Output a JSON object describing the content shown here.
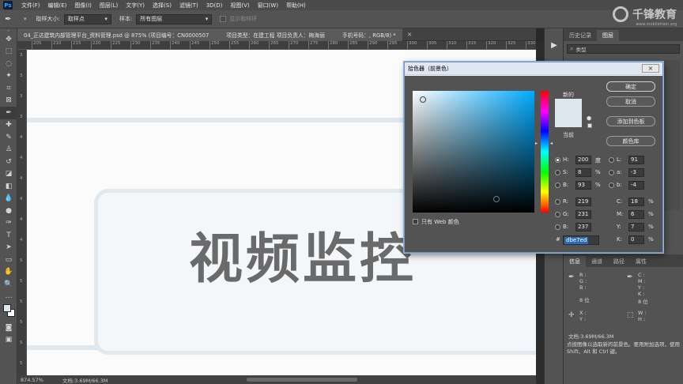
{
  "menubar": {
    "logo": "Ps",
    "items": [
      "文件(F)",
      "编辑(E)",
      "图像(I)",
      "图层(L)",
      "文字(Y)",
      "选择(S)",
      "滤镜(T)",
      "3D(D)",
      "视图(V)",
      "窗口(W)",
      "帮助(H)"
    ]
  },
  "options": {
    "sample_size_label": "取样大小:",
    "sample_size_value": "取样点",
    "sample_label": "样本:",
    "sample_value": "所有图层",
    "show_ring_label": "显示取样环"
  },
  "watermark": {
    "text": "千锋教育",
    "sub": "www.mobiletrain.org"
  },
  "doc_tab": {
    "file": "04_正达建筑内部管理平台_资料管理.psd @ 875% (项目编号：CN0000507",
    "type": "项目类型：在建工程  项目负责人：梅海丽",
    "phone": "手机号码：, RGB/8) *",
    "close": "×"
  },
  "ruler_ticks": [
    "205",
    "210",
    "215",
    "220",
    "225",
    "230",
    "235",
    "240",
    "245",
    "250",
    "255",
    "260",
    "265",
    "270",
    "275",
    "280",
    "285",
    "290",
    "295",
    "300",
    "305",
    "310",
    "315",
    "320",
    "325",
    "330"
  ],
  "ruler_ticks_left": [
    "3",
    "3",
    "3",
    "3",
    "4",
    "4",
    "4",
    "4",
    "4",
    "4",
    "5",
    "5",
    "5",
    "5",
    "5",
    "5"
  ],
  "canvas": {
    "title_text": "视频监控"
  },
  "status": {
    "zoom": "874.57%",
    "doc": "文档:3.69M/66.3M"
  },
  "panels": {
    "top_tabs": [
      "历史记录",
      "图层"
    ],
    "search_kind": "类型",
    "bottom_tabs": [
      "信息",
      "通道",
      "路径",
      "属性"
    ],
    "info": {
      "r": "R :",
      "g": "G :",
      "b": "B :",
      "c": "C :",
      "m": "M :",
      "y": "Y :",
      "k": "K :",
      "bit1": "8 位",
      "bit2": "8 位",
      "x": "X :",
      "yy": "Y :",
      "w": "W :",
      "h": "H :",
      "doc": "文档:3.69M/66.3M",
      "hint": "点按图像以选取新的前景色。要用附加选项，使用 Shift、Alt 和 Ctrl 键。"
    }
  },
  "picker": {
    "title": "拾色器（前景色）",
    "close": "×",
    "new_label": "新的",
    "current_label": "当前",
    "new_color": "#dbe7ed",
    "current_color": "#dbe7ed",
    "ok": "确定",
    "cancel": "取消",
    "add_swatch": "添加到色板",
    "libraries": "颜色库",
    "web_only": "只有 Web 颜色",
    "h_label": "H:",
    "h_value": "200",
    "h_unit": "度",
    "s_label": "S:",
    "s_value": "8",
    "s_unit": "%",
    "bv_label": "B:",
    "bv_value": "93",
    "bv_unit": "%",
    "r_label": "R:",
    "r_value": "219",
    "g_label": "G:",
    "g_value": "231",
    "b_label": "B:",
    "b_value": "237",
    "l_label": "L:",
    "l_value": "91",
    "a_label": "a:",
    "a_value": "-3",
    "lb_label": "b:",
    "lb_value": "-4",
    "c_label": "C:",
    "c_value": "18",
    "c_unit": "%",
    "m_label": "M:",
    "m_value": "6",
    "m_unit": "%",
    "y_label": "Y:",
    "y_value": "7",
    "y_unit": "%",
    "k_label": "K:",
    "k_value": "0",
    "k_unit": "%",
    "hex_label": "#",
    "hex_value": "dbe7ed"
  }
}
